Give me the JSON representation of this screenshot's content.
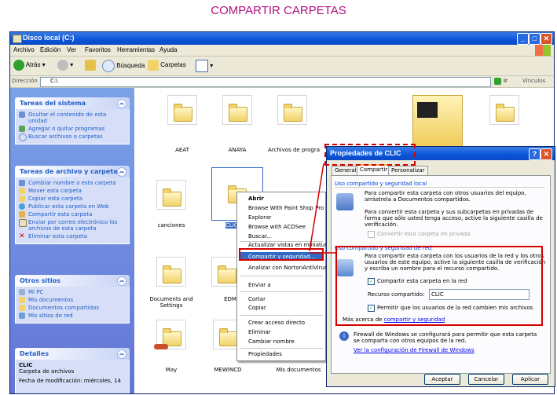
{
  "page_title": "COMPARTIR CARPETAS",
  "window": {
    "title": "Disco local (C:)",
    "menu": [
      "Archivo",
      "Edición",
      "Ver",
      "Favoritos",
      "Herramientas",
      "Ayuda"
    ],
    "toolbar": {
      "back": "Atrás",
      "search": "Búsqueda",
      "folders": "Carpetas"
    },
    "address_label": "Dirección",
    "address_value": "C:\\",
    "go": "Ir",
    "links": "Vínculos"
  },
  "sidebar": {
    "system_tasks": {
      "title": "Tareas del sistema",
      "items": [
        "Ocultar el contenido de esta unidad",
        "Agregar o quitar programas",
        "Buscar archivos o carpetas"
      ]
    },
    "file_tasks": {
      "title": "Tareas de archivo y carpeta",
      "items": [
        "Cambiar nombre a esta carpeta",
        "Mover esta carpeta",
        "Copiar esta carpeta",
        "Publicar esta carpeta en Web",
        "Compartir esta carpeta",
        "Enviar por correo electrónico los archivos de esta carpeta",
        "Eliminar esta carpeta"
      ]
    },
    "other_places": {
      "title": "Otros sitios",
      "items": [
        "Mi PC",
        "Mis documentos",
        "Documentos compartidos",
        "Mis sitios de red"
      ]
    },
    "details": {
      "title": "Detalles",
      "name": "CLIC",
      "type": "Carpeta de archivos",
      "modified": "Fecha de modificación: miércoles, 14"
    }
  },
  "files": [
    "AEAT",
    "ANAYA",
    "Archivos de progra",
    "canciones",
    "CLIC",
    "Documents and Settings",
    "EDM",
    "May",
    "MEWINCD",
    "Mis documentos"
  ],
  "context_menu": [
    "Abrir",
    "Browse With Paint Shop Pro 7",
    "Explorar",
    "Browse with ACDSee",
    "Buscar...",
    "Actualizar vistas en miniatura",
    "Compartir y seguridad...",
    "Analizar con NortonAntiVirus",
    "Enviar a",
    "Cortar",
    "Copiar",
    "Crear acceso directo",
    "Eliminar",
    "Cambiar nombre",
    "Propiedades"
  ],
  "dialog": {
    "title": "Propiedades de CLIC",
    "tabs": [
      "General",
      "Compartir",
      "Personalizar"
    ],
    "local_group": "Uso compartido y seguridad local",
    "local_text1": "Para compartir esta carpeta con otros usuarios del equipo, arrástrela a Documentos compartidos.",
    "local_text2": "Para convertir esta carpeta y sus subcarpetas en privadas de forma que sólo usted tenga acceso, active la siguiente casilla de verificación.",
    "private_cb": "Convertir esta carpeta en privada",
    "network_group": "Uso compartido y seguridad de red",
    "network_text": "Para compartir esta carpeta con los usuarios de la red y los otros usuarios de este equipo, active la siguiente casilla de verificación y escriba un nombre para el recurso compartido.",
    "share_cb": "Compartir esta carpeta en la red",
    "share_name_label": "Recurso compartido:",
    "share_name_value": "CLIC",
    "allow_cb": "Permitir que los usuarios de la red cambien mis archivos",
    "more_info_prefix": "Más acerca de ",
    "more_info_link": "compartir y seguridad",
    "firewall_text": "Firewall de Windows se configurará para permitir que esta carpeta se comparta con otros equipos de la red.",
    "firewall_link": "Ver la configuración de Firewall de Windows",
    "buttons": [
      "Aceptar",
      "Cancelar",
      "Aplicar"
    ]
  },
  "colors": {
    "title_accent": "#b1127f",
    "xp_blue": "#0a54d8",
    "highlight": "#316ac5",
    "annotation_red": "#d40000"
  }
}
